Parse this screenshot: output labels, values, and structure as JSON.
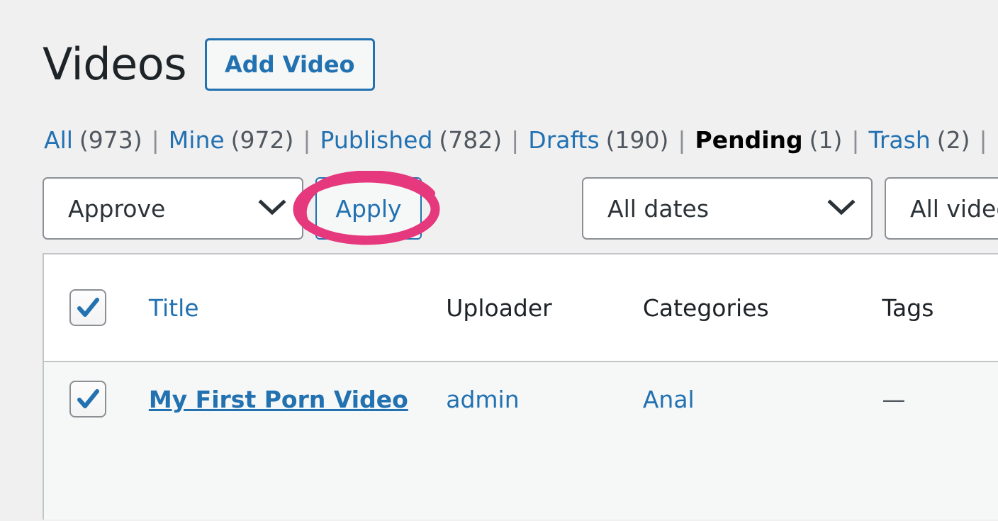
{
  "header": {
    "title": "Videos",
    "add_button": "Add Video"
  },
  "filters": {
    "items": [
      {
        "label": "All",
        "count": "(973)",
        "current": false
      },
      {
        "label": "Mine",
        "count": "(972)",
        "current": false
      },
      {
        "label": "Published",
        "count": "(782)",
        "current": false
      },
      {
        "label": "Drafts",
        "count": "(190)",
        "current": false
      },
      {
        "label": "Pending",
        "count": "(1)",
        "current": true
      },
      {
        "label": "Trash",
        "count": "(2)",
        "current": false
      }
    ],
    "separator": "|"
  },
  "toolbar": {
    "bulk_action_selected": "Approve",
    "apply_label": "Apply",
    "date_filter_selected": "All dates",
    "category_filter_selected": "All video categor",
    "chevron": "⌄"
  },
  "annotation": {
    "shape": "ellipse-circle-highlight",
    "target": "apply-button",
    "color": "#e5387d"
  },
  "table": {
    "columns": [
      {
        "key": "cb",
        "label": "",
        "type": "checkbox"
      },
      {
        "key": "title",
        "label": "Title",
        "link": true
      },
      {
        "key": "uploader",
        "label": "Uploader",
        "link": false
      },
      {
        "key": "categories",
        "label": "Categories",
        "link": false
      },
      {
        "key": "tags",
        "label": "Tags",
        "link": false
      }
    ],
    "select_all_checked": true,
    "rows": [
      {
        "checked": true,
        "title": "My First Porn Video",
        "uploader": "admin",
        "categories": "Anal",
        "tags": "—"
      }
    ]
  },
  "colors": {
    "link": "#2271b1",
    "page_bg": "#f0f0f1",
    "row_bg": "#f6f7f7",
    "annotation": "#e5387d"
  }
}
